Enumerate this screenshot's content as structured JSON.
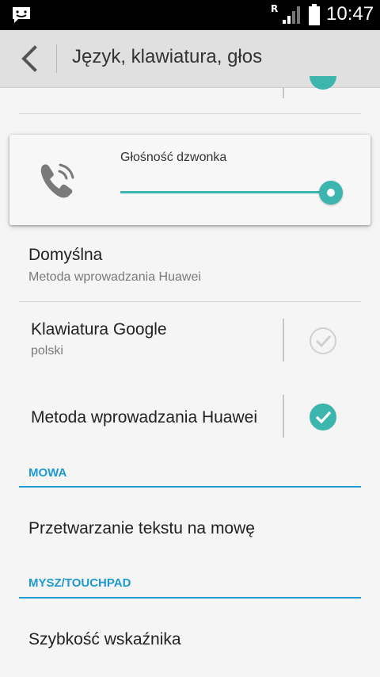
{
  "status_bar": {
    "roaming": "R",
    "time": "10:47",
    "icons": [
      "message-icon",
      "signal-icon",
      "battery-icon"
    ]
  },
  "action_bar": {
    "title": "Język, klawiatura, głos",
    "back_icon": "chevron-left-icon"
  },
  "volume_popup": {
    "label": "Głośność dzwonka",
    "level": 1.0,
    "icon": "ringer-phone-icon",
    "accent": "#3bb5ad"
  },
  "items": {
    "default": {
      "title": "Domyślna",
      "subtitle": "Metoda wprowadzania Huawei"
    },
    "google_keyboard": {
      "title": "Klawiatura Google",
      "subtitle": "polski",
      "checked": false
    },
    "huawei_input": {
      "title": "Metoda wprowadzania Huawei",
      "checked": true
    },
    "tts": {
      "title": "Przetwarzanie tekstu na mowę"
    },
    "pointer_speed": {
      "title": "Szybkość wskaźnika"
    }
  },
  "sections": {
    "speech": "MOWA",
    "mouse": "MYSZ/TOUCHPAD"
  },
  "colors": {
    "section_accent": "#1e9ad0",
    "checkbox_on": "#3bb5ad",
    "checkbox_off": "#d0d0d0"
  }
}
